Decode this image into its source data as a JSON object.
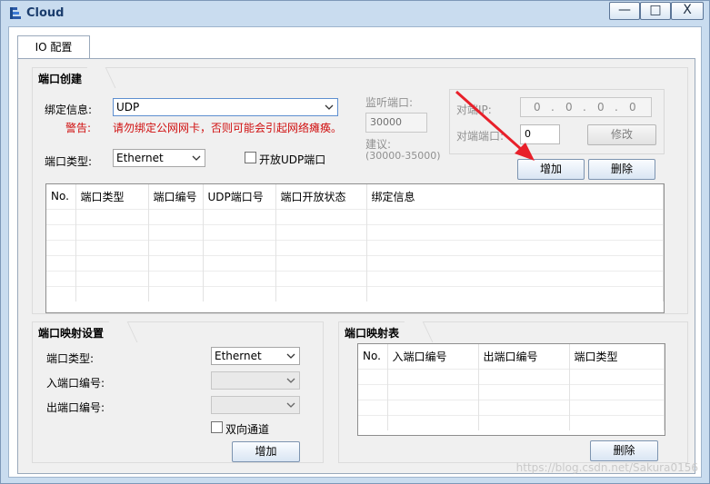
{
  "window": {
    "title": "Cloud",
    "minimize": "—",
    "maximize": "□",
    "close": "X"
  },
  "tab": {
    "label": "IO 配置"
  },
  "port_create": {
    "title": "端口创建",
    "bind_label": "绑定信息:",
    "bind_value": "UDP",
    "warning_label": "警告:",
    "warning_text": "请勿绑定公网网卡，否则可能会引起网络瘫痪。",
    "port_type_label": "端口类型:",
    "port_type_value": "Ethernet",
    "open_udp_label": "开放UDP端口",
    "listen_port_label": "监听端口:",
    "listen_port_value": "30000",
    "suggest_label": "建议:",
    "suggest_range": "(30000-35000)",
    "peer_ip_label": "对端IP:",
    "peer_ip": [
      "0",
      "0",
      "0",
      "0"
    ],
    "peer_port_label": "对端端口:",
    "peer_port_value": "0",
    "modify_button": "修改",
    "add_button": "增加",
    "delete_button": "删除",
    "table_headers": [
      "No.",
      "端口类型",
      "端口编号",
      "UDP端口号",
      "端口开放状态",
      "绑定信息"
    ]
  },
  "port_mapping": {
    "title": "端口映射设置",
    "port_type_label": "端口类型:",
    "port_type_value": "Ethernet",
    "in_port_label": "入端口编号:",
    "out_port_label": "出端口编号:",
    "bidirectional_label": "双向通道",
    "add_button": "增加"
  },
  "mapping_table": {
    "title": "端口映射表",
    "headers": [
      "No.",
      "入端口编号",
      "出端口编号",
      "端口类型"
    ],
    "delete_button": "删除"
  },
  "watermark": "https://blog.csdn.net/Sakura0156",
  "colors": {
    "warning": "#d01010",
    "arrow": "#e8202a",
    "accent": "#5e8fd0"
  }
}
